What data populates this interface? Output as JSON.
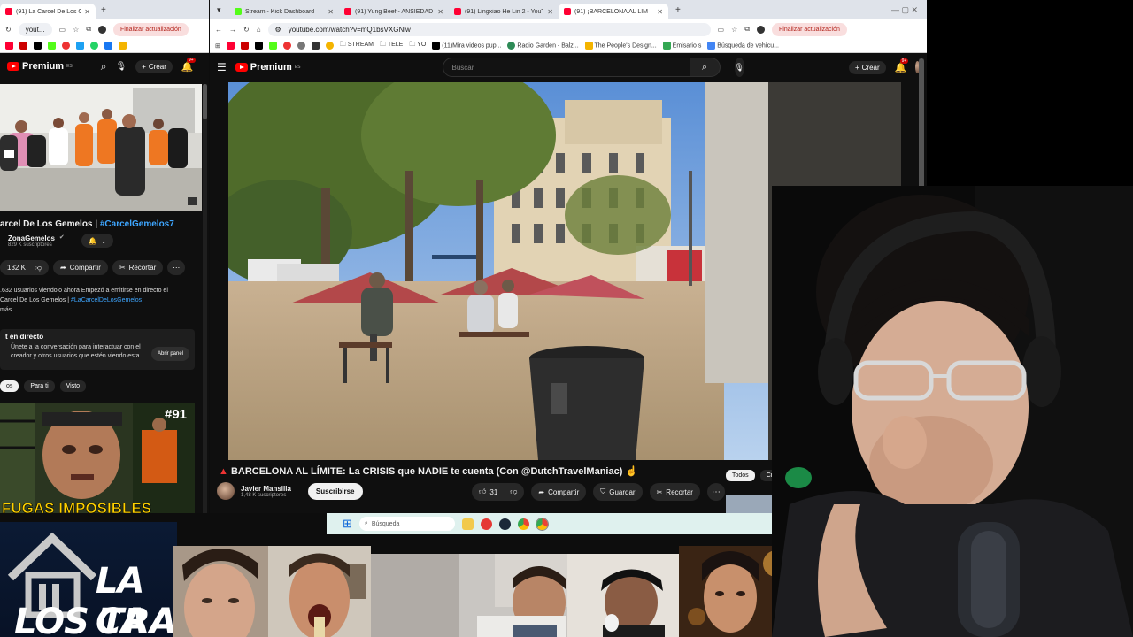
{
  "left_browser": {
    "tab_active": "(91) La Carcel De Los Gemelos",
    "tab2": "yout...",
    "update_label": "Finalizar actualización",
    "yt_brand": "Premium",
    "yt_brand_sup": "ES",
    "crear": "Crear",
    "notif_count": "9+",
    "video_title_main": "arcel De Los Gemelos | ",
    "video_title_hash": "#CarcelGemelos7",
    "channel_name": "ZonaGemelos",
    "channel_subs": "829 K suscriptores",
    "likes": "132 K",
    "share": "Compartir",
    "clip": "Recortar",
    "desc_line1": ".632 usuarios viendolo ahora  Empezó a emitirse en directo el",
    "desc_line2_prefix": "Carcel De Los Gemelos | ",
    "desc_line2_tag": "#LaCarcelDeLosGemelos",
    "desc_line3": "más",
    "live_title": "t en directo",
    "live_desc": "Únete a la conversación para interactuar con el creador y otros usuarios que estén viendo esta...",
    "open_panel": "Abrir panel",
    "chips": [
      "os",
      "Para ti",
      "Visto"
    ],
    "thumb_badge": "#91",
    "thumb_caption": "FUGAS IMPOSIBLES"
  },
  "right_browser": {
    "tabs": [
      {
        "label": "Stream - Kick Dashboard",
        "color": "#53fc18"
      },
      {
        "label": "(91) Yung Beef - ANSIEDAD - Yo",
        "color": "#ff0033"
      },
      {
        "label": "(91) Lingxiao He Lin 2 - YouTub",
        "color": "#ff0033"
      },
      {
        "label": "(91) ¡BARCELONA AL LÍM",
        "color": "#ff0033"
      }
    ],
    "url": "youtube.com/watch?v=mQ1bsVXGNlw",
    "update_label": "Finalizar actualización",
    "bookmarks": [
      "STREAM",
      "TELE",
      "YO",
      "(11)Mira videos pup...",
      "Radio Garden - Balz...",
      "The People's Design...",
      "Emisario s",
      "Búsqueda de vehícu..."
    ],
    "yt_brand": "Premium",
    "yt_brand_sup": "ES",
    "search_placeholder": "Buscar",
    "crear": "Crear",
    "notif_count": "9+",
    "video_title": "BARCELONA AL LÍMITE: La CRISIS que NADIE te cuenta (Con @DutchTravelManiac)",
    "channel_name": "Javier Mansilla",
    "channel_subs": "1,48 K suscriptores",
    "subscribe": "Suscribirse",
    "likes": "31",
    "share": "Compartir",
    "save": "Guardar",
    "clip": "Recortar",
    "chips": [
      "Todos",
      "Crisis"
    ]
  },
  "taskbar": {
    "search_placeholder": "Búsqueda"
  },
  "overlay": {
    "banner_line1": "LA CA",
    "banner_line2": "LOS TRA"
  },
  "colors": {
    "yt_red": "#ff0000",
    "link_blue": "#3ea6ff",
    "kick_green": "#53fc18"
  }
}
